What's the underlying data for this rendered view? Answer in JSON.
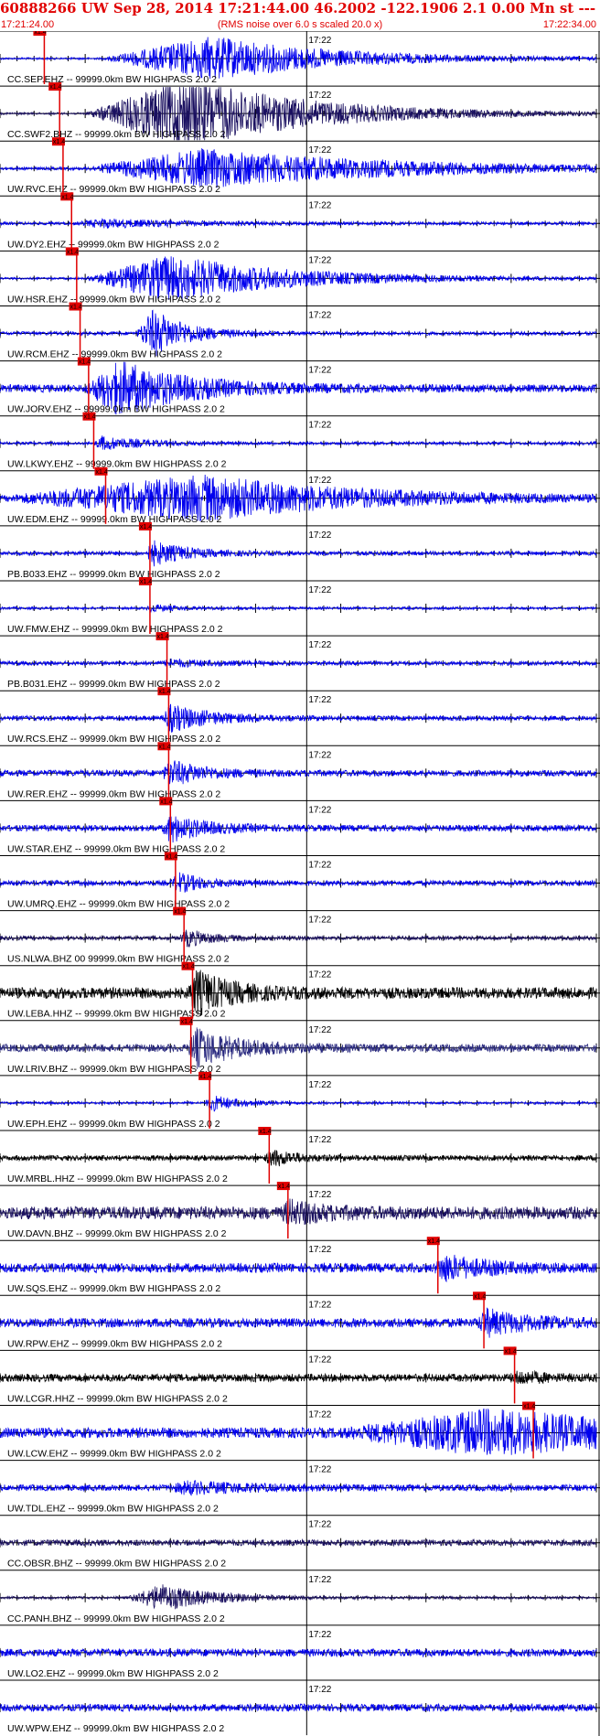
{
  "header": {
    "title": "60888266 UW Sep 28, 2014 17:21:44.00   46.2002 -122.1906  2.1 0.00 Mn st --- -- --   -1",
    "start_time": "17:21:24.00",
    "note": "(RMS noise over 6.0 s scaled 20.0 x)",
    "end_time": "17:22:34.00"
  },
  "colors": {
    "header": "#e00000",
    "pick": "#e00000",
    "frame": "#000000"
  },
  "chart_data": {
    "type": "line",
    "title": "60888266 UW Sep 28, 2014 17:21:44.00   46.2002 -122.1906  2.1 0.00 Mn st --- -- --   -1",
    "x_unit": "time (UTC)",
    "x_range": [
      "17:21:24.00",
      "17:22:34.00"
    ],
    "minute_marker_label": "17:22",
    "pick_label": "x1.4",
    "traces": [
      {
        "label": "CC.SEP.EHZ -- 99999.0km BW  HIGHPASS  2.0  2",
        "color": "#0000ee",
        "pick_s": 5.2,
        "amp": 0.85,
        "onset_s": 12,
        "peak_s": 25,
        "decay_s": 14,
        "noise": 0.04
      },
      {
        "label": "CC.SWF2.BHZ -- 99999.0km BW  HIGHPASS  2.0  2",
        "color": "#1a1060",
        "pick_s": 7.0,
        "amp": 1.4,
        "onset_s": 10,
        "peak_s": 22,
        "decay_s": 14,
        "noise": 0.04
      },
      {
        "label": "UW.RVC.EHZ -- 99999.0km BW  HIGHPASS  2.0  2",
        "color": "#0000ee",
        "pick_s": 7.4,
        "amp": 0.75,
        "onset_s": 10,
        "peak_s": 24,
        "decay_s": 22,
        "noise": 0.06
      },
      {
        "label": "UW.DY2.EHZ -- 99999.0km BW  HIGHPASS  2.0  2",
        "color": "#0000ee",
        "pick_s": 8.4,
        "amp": 0.15,
        "onset_s": 9,
        "peak_s": 12,
        "decay_s": 10,
        "noise": 0.06
      },
      {
        "label": "UW.HSR.EHZ -- 99999.0km BW  HIGHPASS  2.0  2",
        "color": "#0000ee",
        "pick_s": 9.0,
        "amp": 0.9,
        "onset_s": 10,
        "peak_s": 20,
        "decay_s": 14,
        "noise": 0.04
      },
      {
        "label": "UW.RCM.EHZ -- 99999.0km BW  HIGHPASS  2.0  2",
        "color": "#0000ee",
        "pick_s": 9.4,
        "amp": 0.9,
        "onset_s": 16,
        "peak_s": 18,
        "decay_s": 4,
        "noise": 0.07
      },
      {
        "label": "UW.JORV.EHZ -- 99999.0km BW  HIGHPASS  2.0  2",
        "color": "#0000ee",
        "pick_s": 10.4,
        "amp": 1.0,
        "onset_s": 10,
        "peak_s": 14,
        "decay_s": 8,
        "noise": 0.15
      },
      {
        "label": "UW.LKWY.EHZ -- 99999.0km BW  HIGHPASS  2.0  2",
        "color": "#0000ee",
        "pick_s": 11.0,
        "amp": 0.25,
        "onset_s": 11,
        "peak_s": 12,
        "decay_s": 5,
        "noise": 0.06
      },
      {
        "label": "UW.EDM.EHZ -- 99999.0km BW  HIGHPASS  2.0  2",
        "color": "#0000ee",
        "pick_s": 12.4,
        "amp": 0.85,
        "onset_s": 0,
        "peak_s": 24,
        "decay_s": 18,
        "noise": 0.1
      },
      {
        "label": "PB.B033.EHZ -- 99999.0km BW  HIGHPASS  2.0  2",
        "color": "#0000ee",
        "pick_s": 17.6,
        "amp": 0.45,
        "onset_s": 17,
        "peak_s": 18,
        "decay_s": 4,
        "noise": 0.08
      },
      {
        "label": "UW.FMW.EHZ -- 99999.0km BW  HIGHPASS  2.0  2",
        "color": "#0000ee",
        "pick_s": 17.6,
        "amp": 0.12,
        "onset_s": 17,
        "peak_s": 18,
        "decay_s": 3,
        "noise": 0.05
      },
      {
        "label": "PB.B031.EHZ -- 99999.0km BW  HIGHPASS  2.0  2",
        "color": "#0000ee",
        "pick_s": 19.6,
        "amp": 0.12,
        "onset_s": 19,
        "peak_s": 20,
        "decay_s": 5,
        "noise": 0.08
      },
      {
        "label": "UW.RCS.EHZ -- 99999.0km BW  HIGHPASS  2.0  2",
        "color": "#0000ee",
        "pick_s": 19.8,
        "amp": 0.5,
        "onset_s": 19,
        "peak_s": 20,
        "decay_s": 5,
        "noise": 0.09
      },
      {
        "label": "UW.RER.EHZ -- 99999.0km BW  HIGHPASS  2.0  2",
        "color": "#0000ee",
        "pick_s": 19.8,
        "amp": 0.45,
        "onset_s": 19,
        "peak_s": 20,
        "decay_s": 4,
        "noise": 0.12
      },
      {
        "label": "UW.STAR.EHZ -- 99999.0km BW  HIGHPASS  2.0  2",
        "color": "#0000ee",
        "pick_s": 20.0,
        "amp": 0.5,
        "onset_s": 19,
        "peak_s": 20,
        "decay_s": 4,
        "noise": 0.12
      },
      {
        "label": "UW.UMRQ.EHZ -- 99999.0km BW  HIGHPASS  2.0  2",
        "color": "#0000ee",
        "pick_s": 20.6,
        "amp": 0.35,
        "onset_s": 20,
        "peak_s": 21,
        "decay_s": 3,
        "noise": 0.1
      },
      {
        "label": "US.NLWA.BHZ 00 99999.0km BW  HIGHPASS  2.0  2",
        "color": "#1a1060",
        "pick_s": 21.6,
        "amp": 0.3,
        "onset_s": 21,
        "peak_s": 22,
        "decay_s": 3,
        "noise": 0.08
      },
      {
        "label": "UW.LEBA.HHZ -- 99999.0km BW  HIGHPASS  2.0  2",
        "color": "#000000",
        "pick_s": 22.6,
        "amp": 0.8,
        "onset_s": 22,
        "peak_s": 23,
        "decay_s": 4,
        "noise": 0.22
      },
      {
        "label": "UW.LRIV.BHZ -- 99999.0km BW  HIGHPASS  2.0  2",
        "color": "#2a2a80",
        "pick_s": 22.4,
        "amp": 0.7,
        "onset_s": 22,
        "peak_s": 23,
        "decay_s": 5,
        "noise": 0.15
      },
      {
        "label": "UW.EPH.EHZ -- 99999.0km BW  HIGHPASS  2.0  2",
        "color": "#0000ee",
        "pick_s": 24.6,
        "amp": 0.3,
        "onset_s": 24,
        "peak_s": 25,
        "decay_s": 3,
        "noise": 0.05
      },
      {
        "label": "UW.MRBL.HHZ -- 99999.0km BW  HIGHPASS  2.0  2",
        "color": "#000000",
        "pick_s": 31.6,
        "amp": 0.3,
        "onset_s": 31,
        "peak_s": 32,
        "decay_s": 3,
        "noise": 0.1
      },
      {
        "label": "UW.DAVN.BHZ -- 99999.0km BW  HIGHPASS  2.0  2",
        "color": "#1a1060",
        "pick_s": 33.8,
        "amp": 0.35,
        "onset_s": 33,
        "peak_s": 34,
        "decay_s": 4,
        "noise": 0.25
      },
      {
        "label": "UW.SQS.EHZ -- 99999.0km BW  HIGHPASS  2.0  2",
        "color": "#0000ee",
        "pick_s": 51.4,
        "amp": 0.45,
        "onset_s": 51,
        "peak_s": 52,
        "decay_s": 5,
        "noise": 0.18
      },
      {
        "label": "UW.RPW.EHZ -- 99999.0km BW  HIGHPASS  2.0  2",
        "color": "#0000ee",
        "pick_s": 56.8,
        "amp": 0.45,
        "onset_s": 56,
        "peak_s": 57,
        "decay_s": 5,
        "noise": 0.18
      },
      {
        "label": "UW.LCGR.HHZ -- 99999.0km BW  HIGHPASS  2.0  2",
        "color": "#000000",
        "pick_s": 60.4,
        "amp": 0.2,
        "onset_s": 60,
        "peak_s": 61,
        "decay_s": 3,
        "noise": 0.15
      },
      {
        "label": "UW.LCW.EHZ -- 99999.0km BW  HIGHPASS  2.0  2",
        "color": "#0000ee",
        "pick_s": 62.6,
        "amp": 0.8,
        "onset_s": 40,
        "peak_s": 58,
        "decay_s": 20,
        "noise": 0.2
      },
      {
        "label": "UW.TDL.EHZ -- 99999.0km BW  HIGHPASS  2.0  2",
        "color": "#0000ee",
        "pick_s": null,
        "amp": 0.2,
        "onset_s": 20,
        "peak_s": 22,
        "decay_s": 8,
        "noise": 0.12
      },
      {
        "label": "CC.OBSR.BHZ -- 99999.0km BW  HIGHPASS  2.0  2",
        "color": "#1a1060",
        "pick_s": null,
        "amp": 0.0,
        "onset_s": 0,
        "peak_s": 0,
        "decay_s": 1,
        "noise": 0.12
      },
      {
        "label": "CC.PANH.BHZ -- 99999.0km BW  HIGHPASS  2.0  2",
        "color": "#1a1060",
        "pick_s": null,
        "amp": 0.5,
        "onset_s": 15,
        "peak_s": 19,
        "decay_s": 6,
        "noise": 0.05
      },
      {
        "label": "UW.LO2.EHZ -- 99999.0km BW  HIGHPASS  2.0  2",
        "color": "#0000ee",
        "pick_s": null,
        "amp": 0.0,
        "onset_s": 0,
        "peak_s": 0,
        "decay_s": 1,
        "noise": 0.15
      },
      {
        "label": "UW.WPW.EHZ -- 99999.0km BW  HIGHPASS  2.0  2",
        "color": "#0000ee",
        "pick_s": null,
        "amp": 0.0,
        "onset_s": 0,
        "peak_s": 0,
        "decay_s": 1,
        "noise": 0.14
      }
    ]
  }
}
